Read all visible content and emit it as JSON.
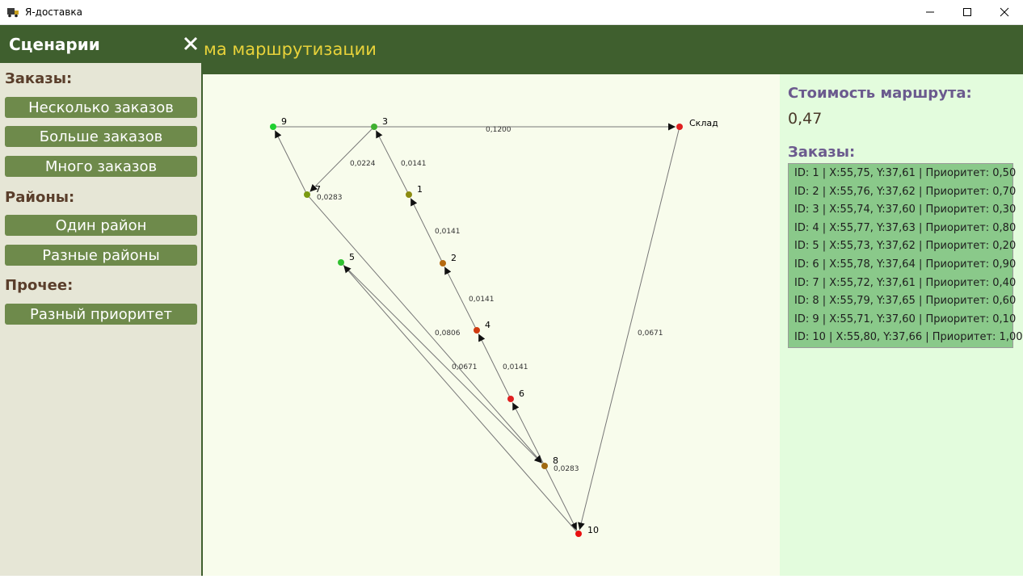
{
  "window": {
    "title": "Я-доставка"
  },
  "header": {
    "title": "ма маршрутизации"
  },
  "sidebar": {
    "title": "Сценарии",
    "sections": [
      {
        "label": "Заказы:",
        "buttons": [
          "Несколько заказов",
          "Больше заказов",
          "Много заказов"
        ]
      },
      {
        "label": "Районы:",
        "buttons": [
          "Один район",
          "Разные районы"
        ]
      },
      {
        "label": "Прочее:",
        "buttons": [
          "Разный приоритет"
        ]
      }
    ]
  },
  "map": {
    "nodes": [
      {
        "id": "sklad",
        "label": "Склад",
        "color": "#e02020"
      },
      {
        "id": "1",
        "label": "1",
        "color": "#8b8b10"
      },
      {
        "id": "2",
        "label": "2",
        "color": "#b56a10"
      },
      {
        "id": "3",
        "label": "3",
        "color": "#40b030"
      },
      {
        "id": "4",
        "label": "4",
        "color": "#d03a10"
      },
      {
        "id": "5",
        "label": "5",
        "color": "#30c030"
      },
      {
        "id": "6",
        "label": "6",
        "color": "#e02020"
      },
      {
        "id": "7",
        "label": "7",
        "color": "#7a9a10"
      },
      {
        "id": "8",
        "label": "8",
        "color": "#a06a10"
      },
      {
        "id": "9",
        "label": "9",
        "color": "#20d030"
      },
      {
        "id": "10",
        "label": "10",
        "color": "#e81010"
      }
    ],
    "edges": [
      {
        "from": "9",
        "to": "sklad",
        "label": "0,1200"
      },
      {
        "from": "3",
        "to": "7",
        "label": "0,0224"
      },
      {
        "from": "1",
        "to": "3",
        "label": "0,0141"
      },
      {
        "from": "2",
        "to": "1",
        "label": "0,0141"
      },
      {
        "from": "4",
        "to": "2",
        "label": "0,0141"
      },
      {
        "from": "6",
        "to": "4",
        "label": "0,0141"
      },
      {
        "from": "8",
        "to": "6",
        "label": ""
      },
      {
        "from": "7",
        "to": "8",
        "label": "0,0806"
      },
      {
        "from": "5",
        "to": "8",
        "label": "0,0671"
      },
      {
        "from": "7",
        "to": "9",
        "label": "0,0283"
      },
      {
        "from": "8",
        "to": "10",
        "label": "0,0283"
      },
      {
        "from": "sklad",
        "to": "10",
        "label": "0,0671"
      },
      {
        "from": "10",
        "to": "5",
        "label": ""
      }
    ]
  },
  "cost": {
    "title": "Стоимость маршрута:",
    "value": "0,47"
  },
  "orders": {
    "title": "Заказы:",
    "items": [
      "ID: 1 | X:55,75, Y:37,61 | Приоритет: 0,50",
      "ID: 2 | X:55,76, Y:37,62 | Приоритет: 0,70",
      "ID: 3 | X:55,74, Y:37,60 | Приоритет: 0,30",
      "ID: 4 | X:55,77, Y:37,63 | Приоритет: 0,80",
      "ID: 5 | X:55,73, Y:37,62 | Приоритет: 0,20",
      "ID: 6 | X:55,78, Y:37,64 | Приоритет: 0,90",
      "ID: 7 | X:55,72, Y:37,61 | Приоритет: 0,40",
      "ID: 8 | X:55,79, Y:37,65 | Приоритет: 0,60",
      "ID: 9 | X:55,71, Y:37,60 | Приоритет: 0,10",
      "ID: 10 | X:55,80, Y:37,66 | Приоритет: 1,00"
    ]
  }
}
